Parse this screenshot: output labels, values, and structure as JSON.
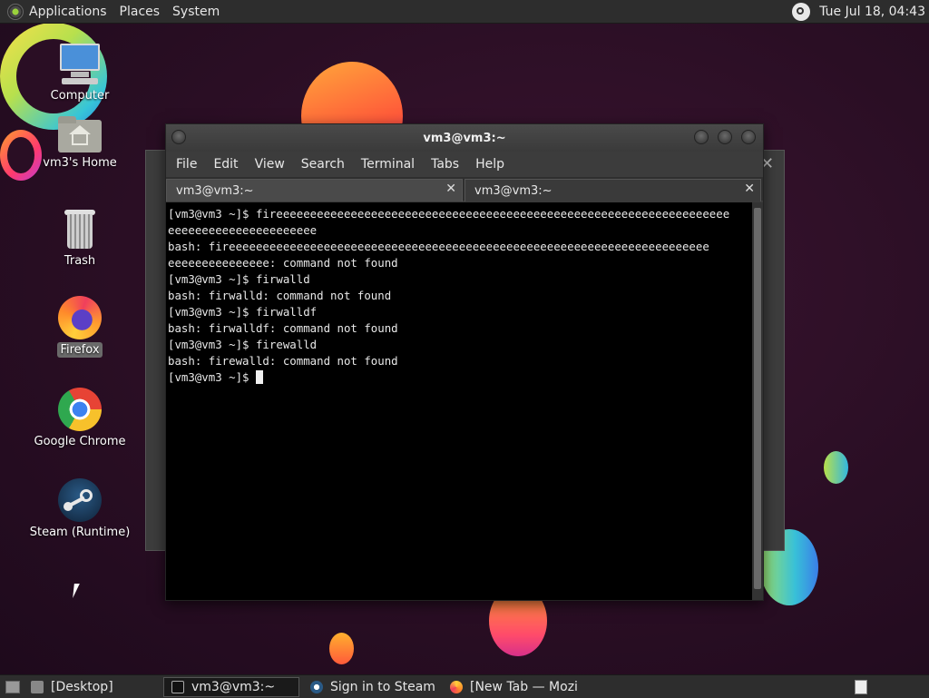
{
  "top_panel": {
    "menus": [
      "Applications",
      "Places",
      "System"
    ],
    "clock": "Tue Jul 18, 04:43"
  },
  "desktop": {
    "icons": [
      {
        "label": "Computer",
        "icon": "computer-icon"
      },
      {
        "label": "vm3's Home",
        "icon": "home-folder-icon"
      },
      {
        "label": "Trash",
        "icon": "trash-icon"
      },
      {
        "label": "Firefox",
        "icon": "firefox-icon"
      },
      {
        "label": "Google Chrome",
        "icon": "chrome-icon"
      },
      {
        "label": "Steam (Runtime)",
        "icon": "steam-icon"
      }
    ]
  },
  "terminal": {
    "title": "vm3@vm3:~",
    "menus": [
      "File",
      "Edit",
      "View",
      "Search",
      "Terminal",
      "Tabs",
      "Help"
    ],
    "tabs": [
      {
        "label": "vm3@vm3:~",
        "close": "✕"
      },
      {
        "label": "vm3@vm3:~",
        "close": "✕"
      }
    ],
    "lines": [
      "[vm3@vm3 ~]$ fireeeeeeeeeeeeeeeeeeeeeeeeeeeeeeeeeeeeeeeeeeeeeeeeeeeeeeeeeeeeeeeeeee",
      "eeeeeeeeeeeeeeeeeeeeee",
      "bash: fireeeeeeeeeeeeeeeeeeeeeeeeeeeeeeeeeeeeeeeeeeeeeeeeeeeeeeeeeeeeeeeeeeeeeee",
      "eeeeeeeeeeeeeee: command not found",
      "[vm3@vm3 ~]$ firwalld",
      "bash: firwalld: command not found",
      "[vm3@vm3 ~]$ firwalldf",
      "bash: firwalldf: command not found",
      "[vm3@vm3 ~]$ firewalld",
      "bash: firewalld: command not found"
    ],
    "prompt": "[vm3@vm3 ~]$ "
  },
  "taskbar": {
    "items": [
      {
        "label": "[Desktop]",
        "icon": "desktop-icon"
      },
      {
        "label": "vm3@vm3:~",
        "icon": "terminal-icon"
      },
      {
        "label": "Sign in to Steam",
        "icon": "steam-icon"
      },
      {
        "label": "[New Tab — Mozilla…",
        "icon": "firefox-icon"
      }
    ]
  },
  "colors": {
    "panel": "#2d2d2d",
    "terminal_bg": "#000000",
    "terminal_fg": "#e8e8e8",
    "desktop_bg": "#2a0e24"
  }
}
